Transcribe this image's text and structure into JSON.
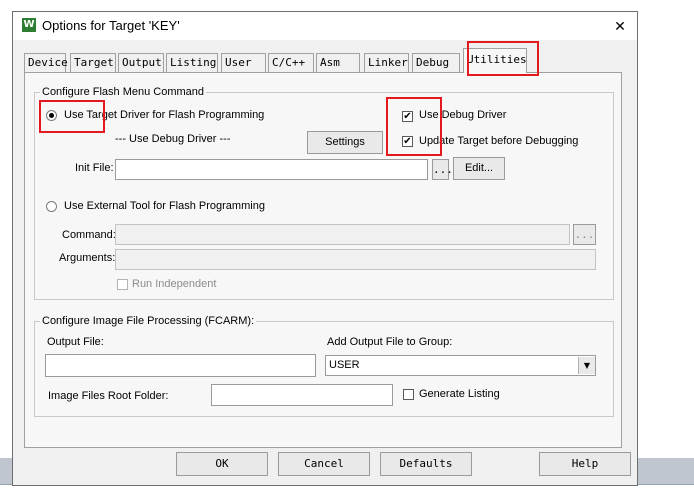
{
  "window": {
    "title": "Options for Target 'KEY'",
    "app_icon": "W",
    "close_glyph": "✕"
  },
  "tabs": [
    "Device",
    "Target",
    "Output",
    "Listing",
    "User",
    "C/C++",
    "Asm",
    "Linker",
    "Debug",
    "Utilities"
  ],
  "active_tab": "Utilities",
  "flash_group": {
    "title": "Configure Flash Menu Command",
    "use_target_driver": "Use Target Driver for Flash Programming",
    "use_target_driver_selected": true,
    "driver_value": "--- Use Debug Driver ---",
    "settings_label": "Settings",
    "use_debug_driver": "Use Debug Driver",
    "use_debug_driver_checked": true,
    "update_target": "Update Target before Debugging",
    "update_target_checked": true,
    "init_file_label": "Init File:",
    "init_file_value": "",
    "browse_label": "...",
    "edit_label": "Edit...",
    "use_external_tool": "Use External Tool for Flash Programming",
    "use_external_tool_selected": false,
    "command_label": "Command:",
    "command_value": "",
    "arguments_label": "Arguments:",
    "arguments_value": "",
    "run_independent": "Run Independent",
    "run_independent_checked": false
  },
  "image_group": {
    "title": "Configure Image File Processing (FCARM):",
    "output_file_label": "Output File:",
    "output_file_value": "",
    "add_output_label": "Add Output File  to Group:",
    "group_value": "USER",
    "root_folder_label": "Image Files Root Folder:",
    "root_folder_value": "",
    "generate_listing": "Generate Listing",
    "generate_listing_checked": false
  },
  "buttons": {
    "ok": "OK",
    "cancel": "Cancel",
    "defaults": "Defaults",
    "help": "Help"
  },
  "colors": {
    "highlight_annotation": "#e3191f",
    "app_icon_bg": "#2e7d32"
  }
}
